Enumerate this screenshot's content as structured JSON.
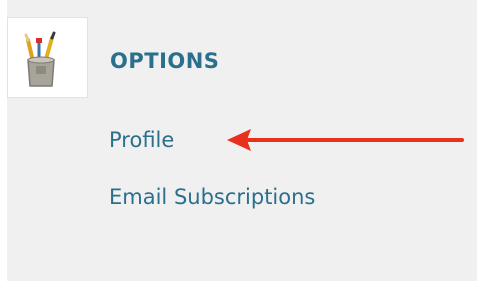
{
  "options": {
    "title": "OPTIONS",
    "icon": "pencil-cup-icon",
    "links": [
      {
        "label": "Profile"
      },
      {
        "label": "Email Subscriptions"
      }
    ]
  },
  "annotation": {
    "arrow_color": "#e8301c",
    "arrow_target": "Profile"
  },
  "colors": {
    "link": "#2a6f8c",
    "panel_bg": "#f0f0f0"
  }
}
